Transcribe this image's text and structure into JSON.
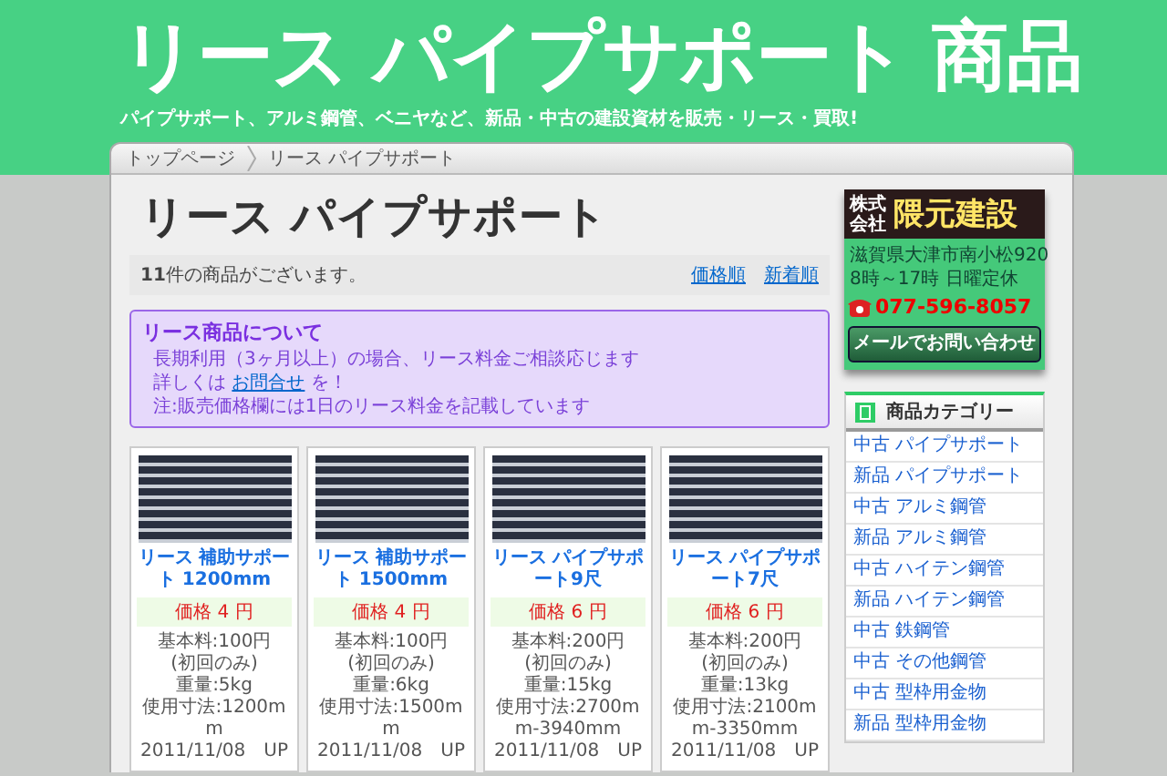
{
  "header": {
    "title": "リース パイプサポート 商品",
    "tagline": "パイプサポート、アルミ鋼管、ベニヤなど、新品・中古の建設資材を販売・リース・買取!"
  },
  "breadcrumb": [
    "トップページ",
    "リース パイプサポート"
  ],
  "page_title": "リース パイプサポート",
  "result_bar": {
    "count": "**11**件の商品がございます。",
    "sort_links": [
      "価格順",
      "新着順"
    ]
  },
  "notice": {
    "title": "リース商品について",
    "line_1": "長期利用（3ヶ月以上）の場合、リース料金ご相談応じます",
    "line_2_before": "詳しくは",
    "line_2_link": "お問合せ",
    "line_2_after": "を！",
    "line_3": "注:販売価格欄には1日のリース料金を記載しています"
  },
  "products": [
    {
      "name": "リース 補助サポート 1200mm",
      "price": "価格 4 円",
      "details": [
        "基本料:100円",
        "(初回のみ)",
        "重量:5kg",
        "使用寸法:1200mm"
      ],
      "date": "2011/11/08　UP"
    },
    {
      "name": "リース 補助サポート 1500mm",
      "price": "価格 4 円",
      "details": [
        "基本料:100円",
        "(初回のみ)",
        "重量:6kg",
        "使用寸法:1500mm"
      ],
      "date": "2011/11/08　UP"
    },
    {
      "name": "リース パイプサポート9尺",
      "price": "価格 6 円",
      "details": [
        "基本料:200円",
        "(初回のみ)",
        "重量:15kg",
        "使用寸法:2700mm-3940mm"
      ],
      "date": "2011/11/08　UP"
    },
    {
      "name": "リース パイプサポート7尺",
      "price": "価格 6 円",
      "details": [
        "基本料:200円",
        "(初回のみ)",
        "重量:13kg",
        "使用寸法:2100mm-3350mm"
      ],
      "date": "2011/11/08　UP"
    }
  ],
  "company": {
    "logo_small": "株式会社",
    "logo_name": "隈元建設",
    "address": "滋賀県大津市南小松920",
    "hours": "8時～17時 日曜定休",
    "phone": "077-596-8057",
    "mail_button": "メールでお問い合わせ"
  },
  "categories": {
    "title": "商品カテゴリー",
    "items": [
      "中古 パイプサポート",
      "新品 パイプサポート",
      "中古 アルミ鋼管",
      "新品 アルミ鋼管",
      "中古 ハイテン鋼管",
      "新品 ハイテン鋼管",
      "中古 鉄鋼管",
      "中古 その他鋼管",
      "中古 型枠用金物",
      "新品 型枠用金物"
    ]
  }
}
